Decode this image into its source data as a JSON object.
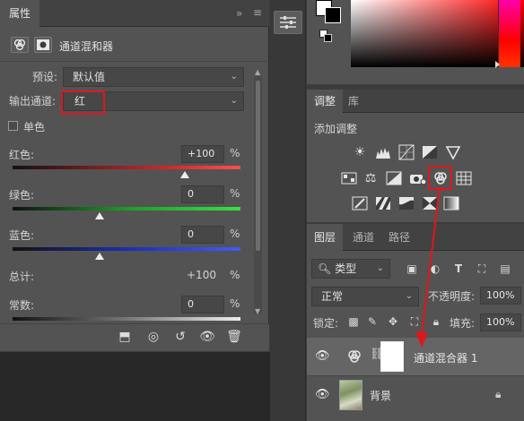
{
  "properties_panel": {
    "tab_label": "属性",
    "collapse_glyph": "»",
    "menu_glyph": "≡",
    "title": "通道混和器",
    "preset_label": "预设:",
    "preset_value": "默认值",
    "output_channel_label": "输出通道:",
    "output_channel_value": "红",
    "monochrome_label": "单色",
    "sliders": [
      {
        "label": "红色:",
        "value": "+100",
        "unit": "%",
        "level": 1.0
      },
      {
        "label": "绿色:",
        "value": "0",
        "unit": "%",
        "level": 0.5
      },
      {
        "label": "蓝色:",
        "value": "0",
        "unit": "%",
        "level": 0.5
      }
    ],
    "total_label": "总计:",
    "total_value": "+100",
    "total_unit": "%",
    "constant_label": "常数:",
    "constant_value": "0",
    "constant_unit": "%"
  },
  "adjustments_panel": {
    "tabs": [
      "调整",
      "库"
    ],
    "add_adjustment_label": "添加调整",
    "row1_icons": [
      "brightness-icon",
      "levels-icon",
      "curves-icon",
      "exposure-icon",
      "vibrance-icon"
    ],
    "row2_icons": [
      "hue-saturation-icon",
      "color-balance-icon",
      "black-white-icon",
      "photo-filter-icon",
      "channel-mixer-icon",
      "color-lookup-icon"
    ],
    "row3_icons": [
      "invert-icon",
      "posterize-icon",
      "threshold-icon",
      "selective-color-icon",
      "gradient-map-icon"
    ]
  },
  "layers_panel": {
    "tabs": [
      "图层",
      "通道",
      "路径"
    ],
    "filter_kind": "类型",
    "blend_mode": "正常",
    "opacity_label": "不透明度:",
    "opacity_value": "100%",
    "lock_label": "锁定:",
    "fill_label": "填充:",
    "fill_value": "100%",
    "layers": [
      {
        "name": "通道混合器 1",
        "type": "adjustment"
      },
      {
        "name": "背景",
        "type": "background",
        "locked": true
      }
    ]
  },
  "colors": {
    "accent_highlight": "#e0161e",
    "panel_bg": "#535353"
  }
}
